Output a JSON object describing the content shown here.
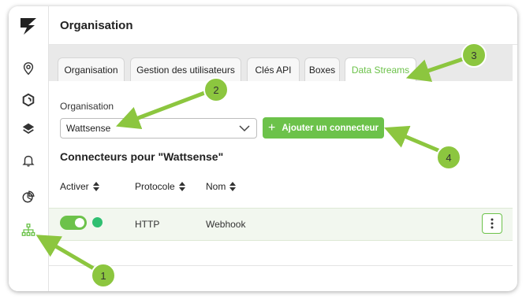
{
  "header": {
    "title": "Organisation"
  },
  "tabs": [
    {
      "label": "Organisation"
    },
    {
      "label": "Gestion des utilisateurs"
    },
    {
      "label": "Clés API"
    },
    {
      "label": "Boxes"
    },
    {
      "label": "Data Streams",
      "active": true
    }
  ],
  "organisation_field": {
    "label": "Organisation",
    "value": "Wattsense"
  },
  "add_button": {
    "label": "Ajouter un connecteur"
  },
  "section": {
    "title": "Connecteurs pour \"Wattsense\""
  },
  "table": {
    "columns": [
      "Activer",
      "Protocole",
      "Nom"
    ],
    "rows": [
      {
        "enabled": true,
        "status": "active",
        "protocol": "HTTP",
        "name": "Webhook"
      }
    ]
  },
  "sidebar": {
    "icons": [
      "logo-icon",
      "location-pin-icon",
      "hexagon-icon",
      "layers-icon",
      "bell-icon",
      "pie-chart-icon",
      "sitemap-icon"
    ]
  },
  "annotations": {
    "badges": [
      "1",
      "2",
      "3",
      "4"
    ]
  },
  "colors": {
    "accent": "#6cc24a",
    "status_dot": "#2fbf71",
    "tab_bar": "#e9e9e9"
  }
}
